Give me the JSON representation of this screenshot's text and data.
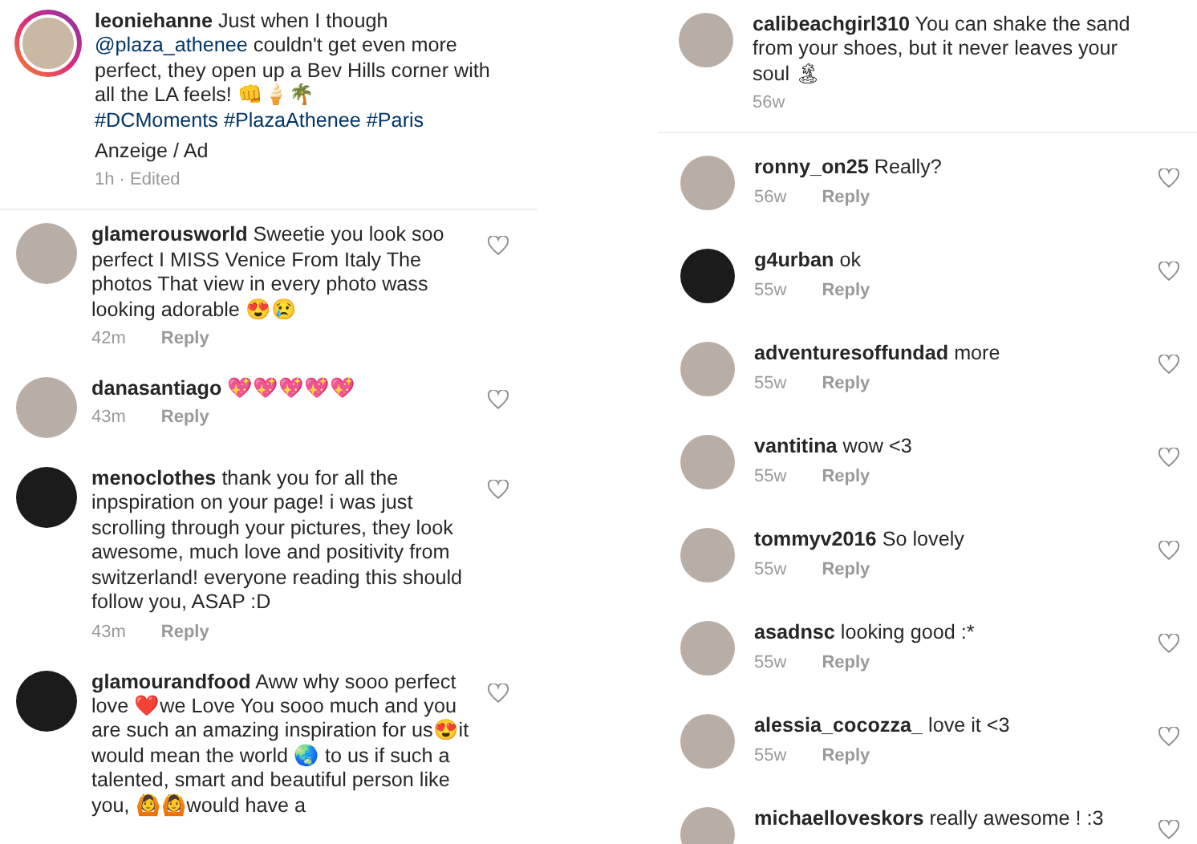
{
  "panels": [
    {
      "caption": {
        "username": "leoniehanne",
        "parts": [
          {
            "text": "Just when I though ",
            "link": false
          },
          {
            "text": "@plaza_athenee",
            "link": true
          },
          {
            "text": " couldn't get even more perfect, they open up a Bev Hills corner with all the LA feels! 👊🍦🌴 ",
            "link": false
          },
          {
            "text": "#DCMoments #PlazaAthenee #Paris",
            "link": true
          }
        ],
        "note": "Anzeige / Ad",
        "time": "1h · Edited"
      },
      "comments": [
        {
          "username": "glamerousworld",
          "text": "Sweetie you look soo perfect I MISS Venice From Italy The photos That view in every photo wass looking adorable 😍😢",
          "time": "42m",
          "reply": "Reply"
        },
        {
          "username": "danasantiago",
          "text": "💖💖💖💖💖",
          "time": "43m",
          "reply": "Reply"
        },
        {
          "username": "menoclothes",
          "text": "thank you for all the inpspiration on your page! i was just scrolling through your pictures, they look awesome, much love and positivity from switzerland! everyone reading this should follow you, ASAP :D",
          "time": "43m",
          "reply": "Reply"
        },
        {
          "username": "glamourandfood",
          "text": "Aww why sooo perfect love ❤️we Love You sooo much and you are such an amazing inspiration for us😍it would mean the world 🌏 to us if such a talented, smart and beautiful person like you, 🙆🙆would have a"
        }
      ]
    },
    {
      "caption": {
        "username": "calibeachgirl310",
        "parts": [
          {
            "text": "You can shake the sand from your shoes, but it never leaves your soul 🏝",
            "link": false
          }
        ],
        "time": "56w"
      },
      "comments": [
        {
          "username": "ronny_on25",
          "text": "Really?",
          "time": "56w",
          "reply": "Reply"
        },
        {
          "username": "g4urban",
          "text": "ok",
          "time": "55w",
          "reply": "Reply"
        },
        {
          "username": "adventuresoffundad",
          "text": "more",
          "time": "55w",
          "reply": "Reply"
        },
        {
          "username": "vantitina",
          "text": "wow <3",
          "time": "55w",
          "reply": "Reply"
        },
        {
          "username": "tommyv2016",
          "text": "So lovely",
          "time": "55w",
          "reply": "Reply"
        },
        {
          "username": "asadnsc",
          "text": "looking good :*",
          "time": "55w",
          "reply": "Reply"
        },
        {
          "username": "alessia_cocozza_",
          "text": "love it <3",
          "time": "55w",
          "reply": "Reply"
        },
        {
          "username": "michaelloveskors",
          "text": "really awesome ! :3"
        }
      ]
    }
  ]
}
